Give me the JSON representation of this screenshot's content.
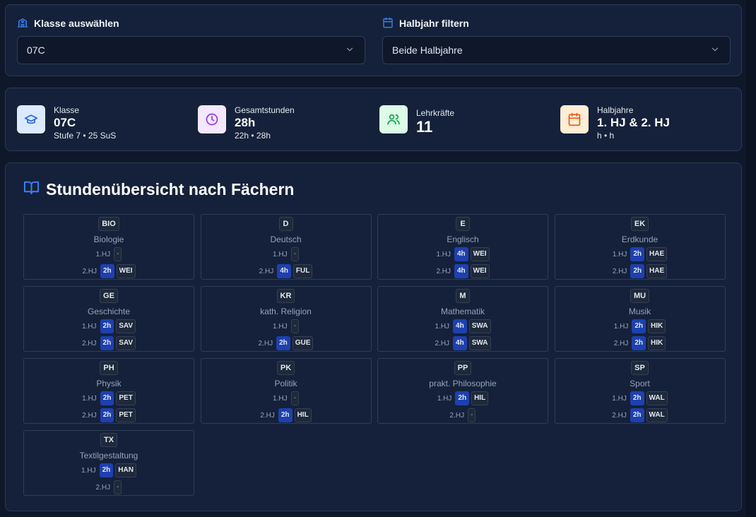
{
  "filters": {
    "klasse": {
      "label": "Klasse auswählen",
      "value": "07C"
    },
    "halbjahr": {
      "label": "Halbjahr filtern",
      "value": "Beide Halbjahre"
    }
  },
  "stats": [
    {
      "name": "klasse",
      "label": "Klasse",
      "value": "07C",
      "sub": "Stufe 7 • 25 SuS",
      "icon": "graduation-cap-icon",
      "color": "#2563eb",
      "bg": "#dbeafe"
    },
    {
      "name": "gesamtstunden",
      "label": "Gesamtstunden",
      "value": "28h",
      "sub": "22h • 28h",
      "icon": "clock-icon",
      "color": "#9333ea",
      "bg": "#f3e8ff"
    },
    {
      "name": "lehrkraefte",
      "label": "Lehrkräfte",
      "value": "11",
      "sub": "",
      "icon": "users-icon",
      "color": "#16a34a",
      "bg": "#dcfce7"
    },
    {
      "name": "halbjahre",
      "label": "Halbjahre",
      "value": "1. HJ & 2. HJ",
      "sub": "h • h",
      "icon": "calendar-icon",
      "color": "#ea580c",
      "bg": "#ffedd5"
    }
  ],
  "section": {
    "title": "Stundenübersicht nach Fächern"
  },
  "subjects": [
    {
      "code": "BIO",
      "name": "Biologie",
      "semesters": [
        {
          "label": "1.HJ",
          "hours": "",
          "teacher": ""
        },
        {
          "label": "2.HJ",
          "hours": "2h",
          "teacher": "WEI"
        }
      ]
    },
    {
      "code": "D",
      "name": "Deutsch",
      "semesters": [
        {
          "label": "1.HJ",
          "hours": "",
          "teacher": ""
        },
        {
          "label": "2.HJ",
          "hours": "4h",
          "teacher": "FUL"
        }
      ]
    },
    {
      "code": "E",
      "name": "Englisch",
      "semesters": [
        {
          "label": "1.HJ",
          "hours": "4h",
          "teacher": "WEI"
        },
        {
          "label": "2.HJ",
          "hours": "4h",
          "teacher": "WEI"
        }
      ]
    },
    {
      "code": "EK",
      "name": "Erdkunde",
      "semesters": [
        {
          "label": "1.HJ",
          "hours": "2h",
          "teacher": "HAE"
        },
        {
          "label": "2.HJ",
          "hours": "2h",
          "teacher": "HAE"
        }
      ]
    },
    {
      "code": "GE",
      "name": "Geschichte",
      "semesters": [
        {
          "label": "1.HJ",
          "hours": "2h",
          "teacher": "SAV"
        },
        {
          "label": "2.HJ",
          "hours": "2h",
          "teacher": "SAV"
        }
      ]
    },
    {
      "code": "KR",
      "name": "kath. Religion",
      "semesters": [
        {
          "label": "1.HJ",
          "hours": "",
          "teacher": ""
        },
        {
          "label": "2.HJ",
          "hours": "2h",
          "teacher": "GUE"
        }
      ]
    },
    {
      "code": "M",
      "name": "Mathematik",
      "semesters": [
        {
          "label": "1.HJ",
          "hours": "4h",
          "teacher": "SWA"
        },
        {
          "label": "2.HJ",
          "hours": "4h",
          "teacher": "SWA"
        }
      ]
    },
    {
      "code": "MU",
      "name": "Musik",
      "semesters": [
        {
          "label": "1.HJ",
          "hours": "2h",
          "teacher": "HIK"
        },
        {
          "label": "2.HJ",
          "hours": "2h",
          "teacher": "HIK"
        }
      ]
    },
    {
      "code": "PH",
      "name": "Physik",
      "semesters": [
        {
          "label": "1.HJ",
          "hours": "2h",
          "teacher": "PET"
        },
        {
          "label": "2.HJ",
          "hours": "2h",
          "teacher": "PET"
        }
      ]
    },
    {
      "code": "PK",
      "name": "Politik",
      "semesters": [
        {
          "label": "1.HJ",
          "hours": "",
          "teacher": ""
        },
        {
          "label": "2.HJ",
          "hours": "2h",
          "teacher": "HIL"
        }
      ]
    },
    {
      "code": "PP",
      "name": "prakt. Philosophie",
      "semesters": [
        {
          "label": "1.HJ",
          "hours": "2h",
          "teacher": "HIL"
        },
        {
          "label": "2.HJ",
          "hours": "",
          "teacher": ""
        }
      ]
    },
    {
      "code": "SP",
      "name": "Sport",
      "semesters": [
        {
          "label": "1.HJ",
          "hours": "2h",
          "teacher": "WAL"
        },
        {
          "label": "2.HJ",
          "hours": "2h",
          "teacher": "WAL"
        }
      ]
    },
    {
      "code": "TX",
      "name": "Textilgestaltung",
      "semesters": [
        {
          "label": "1.HJ",
          "hours": "2h",
          "teacher": "HAN"
        },
        {
          "label": "2.HJ",
          "hours": "",
          "teacher": ""
        }
      ]
    }
  ],
  "empty_marker": "-"
}
